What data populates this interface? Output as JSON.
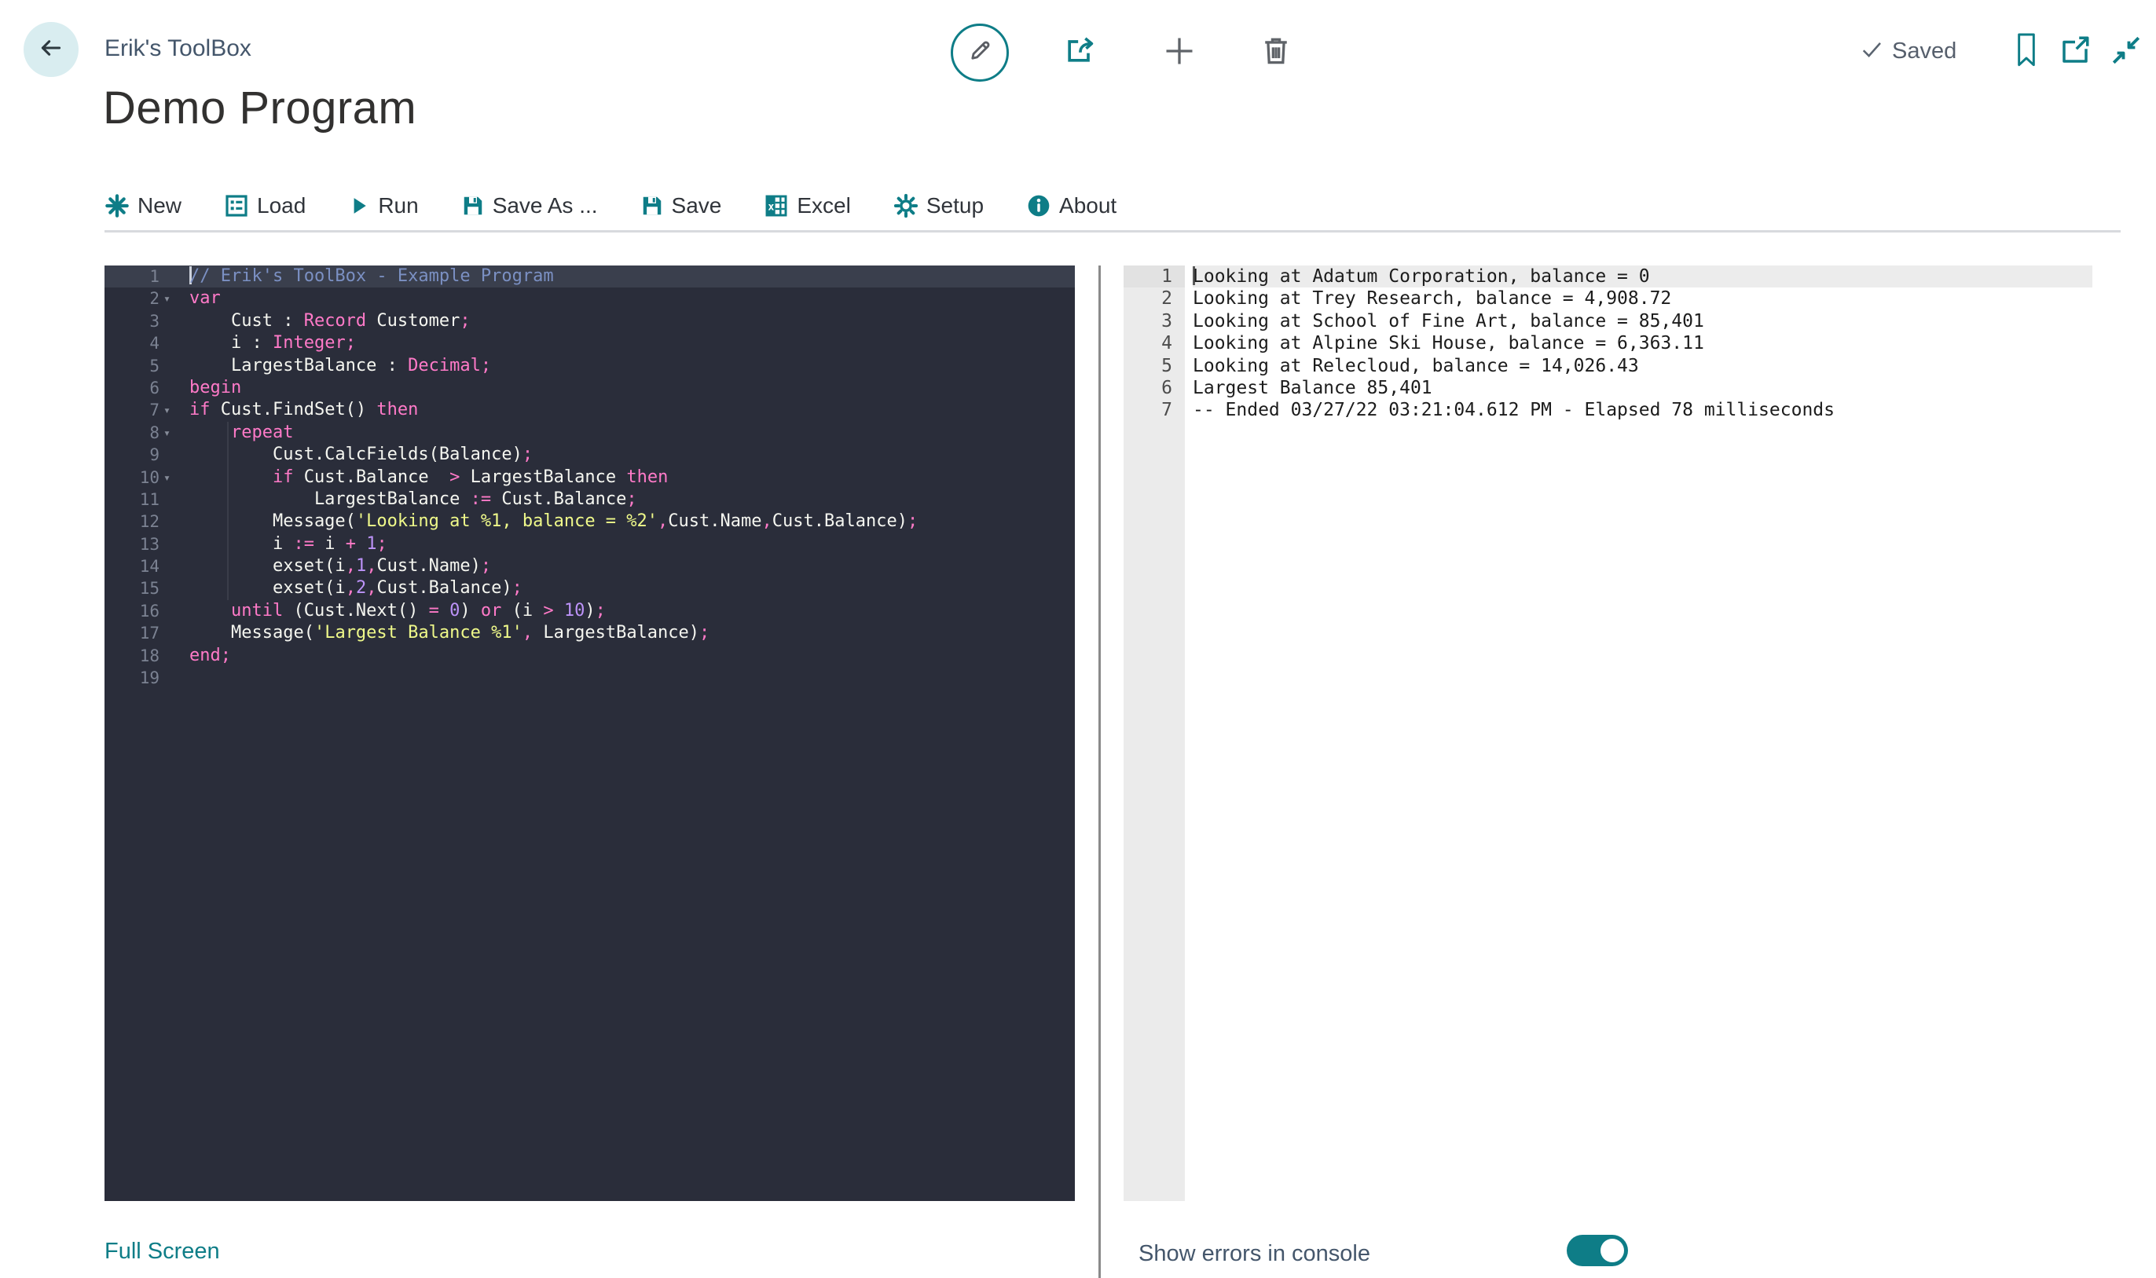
{
  "colors": {
    "accent_teal": "#0e7d87",
    "label_blue_gray": "#44566b",
    "editor_bg": "#2a2d3a",
    "editor_active_line_bg": "#3a3f4d",
    "token_comment": "#7b90c3",
    "token_keyword": "#ff7ac8",
    "token_plain": "#f5f6f0",
    "token_string": "#eff98a",
    "token_number": "#bd93f9",
    "console_gutter_bg": "#ebebeb",
    "console_active_line_bg": "#ececec"
  },
  "header": {
    "app_title": "Erik's ToolBox",
    "page_title": "Demo Program",
    "saved_label": "Saved"
  },
  "toolbar": {
    "items": [
      {
        "label": "New",
        "icon": "new-sparkle-icon"
      },
      {
        "label": "Load",
        "icon": "load-form-icon"
      },
      {
        "label": "Run",
        "icon": "run-play-icon"
      },
      {
        "label": "Save As ...",
        "icon": "save-as-floppy-icon"
      },
      {
        "label": "Save",
        "icon": "save-floppy-icon"
      },
      {
        "label": "Excel",
        "icon": "excel-grid-icon"
      },
      {
        "label": "Setup",
        "icon": "setup-gear-icon"
      },
      {
        "label": "About",
        "icon": "about-info-icon"
      }
    ]
  },
  "editor": {
    "active_line": 1,
    "fold_lines": [
      2,
      7,
      8,
      10
    ],
    "lines": [
      {
        "n": 1,
        "tokens": [
          [
            "c",
            "// Erik's ToolBox - Example Program"
          ]
        ]
      },
      {
        "n": 2,
        "tokens": [
          [
            "k",
            "var"
          ]
        ]
      },
      {
        "n": 3,
        "tokens": [
          [
            "w",
            "    Cust : "
          ],
          [
            "k",
            "Record"
          ],
          [
            "w",
            " Customer"
          ],
          [
            "k",
            ";"
          ]
        ]
      },
      {
        "n": 4,
        "tokens": [
          [
            "w",
            "    i : "
          ],
          [
            "k",
            "Integer"
          ],
          [
            "k",
            ";"
          ]
        ]
      },
      {
        "n": 5,
        "tokens": [
          [
            "w",
            "    LargestBalance : "
          ],
          [
            "k",
            "Decimal"
          ],
          [
            "k",
            ";"
          ]
        ]
      },
      {
        "n": 6,
        "tokens": [
          [
            "k",
            "begin"
          ]
        ]
      },
      {
        "n": 7,
        "tokens": [
          [
            "k",
            "if"
          ],
          [
            "w",
            " Cust.FindSet() "
          ],
          [
            "k",
            "then"
          ]
        ]
      },
      {
        "n": 8,
        "tokens": [
          [
            "w",
            "    "
          ],
          [
            "k",
            "repeat"
          ]
        ]
      },
      {
        "n": 9,
        "tokens": [
          [
            "w",
            "        Cust.CalcFields(Balance)"
          ],
          [
            "k",
            ";"
          ]
        ]
      },
      {
        "n": 10,
        "tokens": [
          [
            "w",
            "        "
          ],
          [
            "k",
            "if"
          ],
          [
            "w",
            " Cust.Balance  "
          ],
          [
            "k",
            ">"
          ],
          [
            "w",
            " LargestBalance "
          ],
          [
            "k",
            "then"
          ]
        ]
      },
      {
        "n": 11,
        "tokens": [
          [
            "w",
            "            LargestBalance "
          ],
          [
            "k",
            ":="
          ],
          [
            "w",
            " Cust.Balance"
          ],
          [
            "k",
            ";"
          ]
        ]
      },
      {
        "n": 12,
        "tokens": [
          [
            "w",
            "        Message("
          ],
          [
            "s",
            "'Looking at %1, balance = %2'"
          ],
          [
            "k",
            ","
          ],
          [
            "w",
            "Cust.Name"
          ],
          [
            "k",
            ","
          ],
          [
            "w",
            "Cust.Balance)"
          ],
          [
            "k",
            ";"
          ]
        ]
      },
      {
        "n": 13,
        "tokens": [
          [
            "w",
            "        i "
          ],
          [
            "k",
            ":="
          ],
          [
            "w",
            " i "
          ],
          [
            "k",
            "+"
          ],
          [
            "w",
            " "
          ],
          [
            "n",
            "1"
          ],
          [
            "k",
            ";"
          ]
        ]
      },
      {
        "n": 14,
        "tokens": [
          [
            "w",
            "        exset(i"
          ],
          [
            "k",
            ","
          ],
          [
            "n",
            "1"
          ],
          [
            "k",
            ","
          ],
          [
            "w",
            "Cust.Name)"
          ],
          [
            "k",
            ";"
          ]
        ]
      },
      {
        "n": 15,
        "tokens": [
          [
            "w",
            "        exset(i"
          ],
          [
            "k",
            ","
          ],
          [
            "n",
            "2"
          ],
          [
            "k",
            ","
          ],
          [
            "w",
            "Cust.Balance)"
          ],
          [
            "k",
            ";"
          ]
        ]
      },
      {
        "n": 16,
        "tokens": [
          [
            "w",
            "    "
          ],
          [
            "k",
            "until"
          ],
          [
            "w",
            " (Cust.Next() "
          ],
          [
            "k",
            "="
          ],
          [
            "w",
            " "
          ],
          [
            "n",
            "0"
          ],
          [
            "w",
            ") "
          ],
          [
            "k",
            "or"
          ],
          [
            "w",
            " (i "
          ],
          [
            "k",
            ">"
          ],
          [
            "w",
            " "
          ],
          [
            "n",
            "10"
          ],
          [
            "w",
            ")"
          ],
          [
            "k",
            ";"
          ]
        ]
      },
      {
        "n": 17,
        "tokens": [
          [
            "w",
            "    Message("
          ],
          [
            "s",
            "'Largest Balance %1'"
          ],
          [
            "k",
            ","
          ],
          [
            "w",
            " LargestBalance)"
          ],
          [
            "k",
            ";"
          ]
        ]
      },
      {
        "n": 18,
        "tokens": [
          [
            "k",
            "end;"
          ]
        ]
      },
      {
        "n": 19,
        "tokens": []
      }
    ]
  },
  "console": {
    "active_line": 1,
    "lines": [
      "Looking at Adatum Corporation, balance = 0",
      "Looking at Trey Research, balance = 4,908.72",
      "Looking at School of Fine Art, balance = 85,401",
      "Looking at Alpine Ski House, balance = 6,363.11",
      "Looking at Relecloud, balance = 14,026.43",
      "Largest Balance 85,401",
      "-- Ended 03/27/22 03:21:04.612 PM - Elapsed 78 milliseconds"
    ]
  },
  "footer": {
    "full_screen_label": "Full Screen",
    "show_errors_label": "Show errors in console",
    "show_errors_on": true
  }
}
